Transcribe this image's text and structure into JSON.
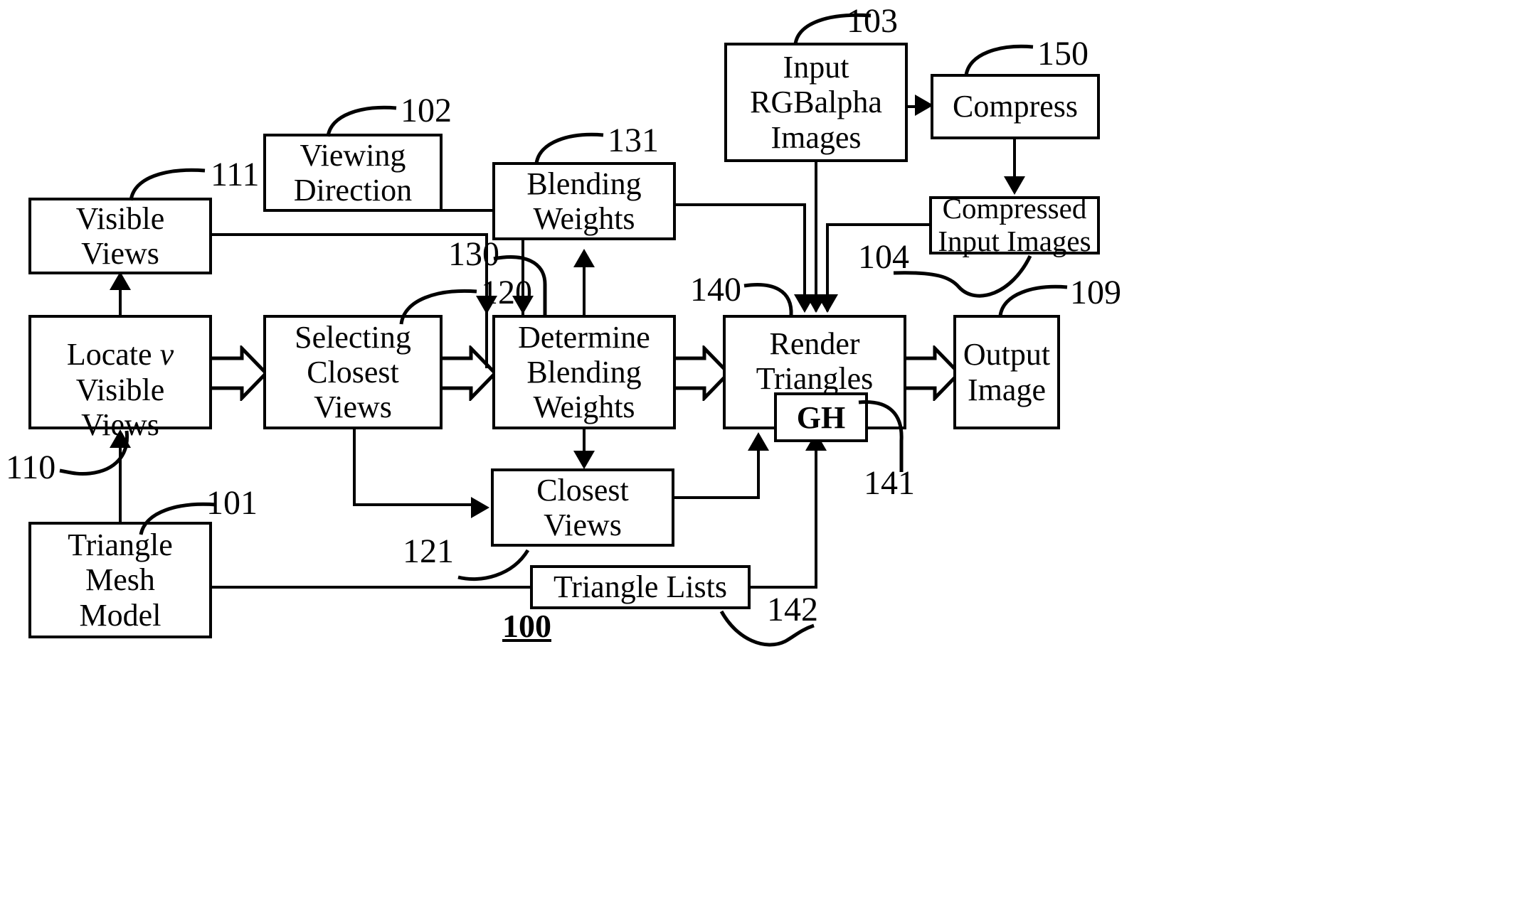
{
  "figure": {
    "figure_number": "100",
    "title_note": "Rendering pipeline block diagram"
  },
  "boxes": {
    "visible_views": {
      "label": "Visible\nViews",
      "ref": "111"
    },
    "viewing_direction": {
      "label": "Viewing\nDirection",
      "ref": "102"
    },
    "blending_weights_store": {
      "label": "Blending\nWeights",
      "ref": "131"
    },
    "input_rgbalpha_images": {
      "label": "Input\nRGBalpha\nImages",
      "ref": "103"
    },
    "compress": {
      "label": "Compress",
      "ref": "150"
    },
    "compressed_input_images": {
      "label": "Compressed\nInput Images",
      "ref": "104"
    },
    "locate_visible_views": {
      "label_part1": "Locate ",
      "label_italic": "v",
      "label_part2": "\nVisible\nViews",
      "ref": "110"
    },
    "selecting_closest_views": {
      "label": "Selecting\nClosest\nViews",
      "ref": "120"
    },
    "determine_blending_weights": {
      "label": "Determine\nBlending\nWeights",
      "ref": "130"
    },
    "render_triangles": {
      "label": "Render\nTriangles",
      "ref": "140"
    },
    "output_image": {
      "label": "Output\nImage",
      "ref": "109"
    },
    "gh_unit": {
      "label": "GH",
      "ref": "141"
    },
    "closest_views": {
      "label": "Closest\nViews",
      "ref": "121"
    },
    "triangle_mesh_model": {
      "label": "Triangle\nMesh\nModel",
      "ref": "101"
    },
    "triangle_lists": {
      "label": "Triangle Lists",
      "ref": "142"
    }
  },
  "reference_numerals": {
    "r100": "100",
    "r101": "101",
    "r102": "102",
    "r103": "103",
    "r104": "104",
    "r109": "109",
    "r110": "110",
    "r111": "111",
    "r120": "120",
    "r121": "121",
    "r130": "130",
    "r131": "131",
    "r140": "140",
    "r141": "141",
    "r142": "142",
    "r150": "150"
  },
  "colors": {
    "line": "#000000",
    "background": "#ffffff"
  }
}
